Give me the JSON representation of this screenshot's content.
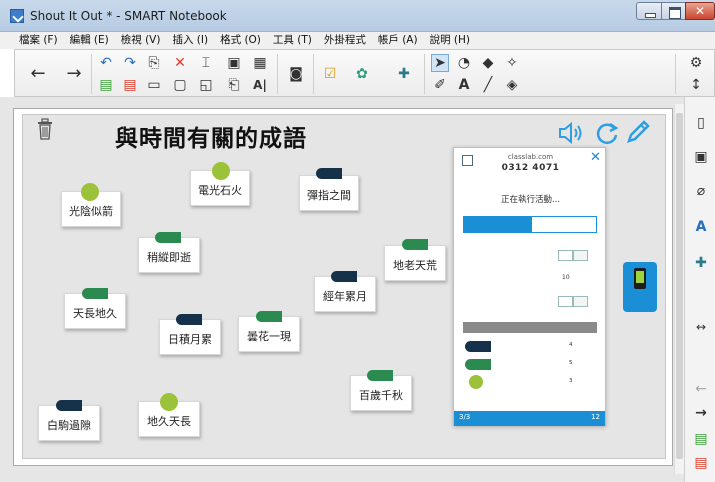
{
  "window": {
    "title": "Shout It Out * - SMART Notebook"
  },
  "menu": [
    "檔案 (F)",
    "編輯 (E)",
    "檢視 (V)",
    "插入 (I)",
    "格式 (O)",
    "工具 (T)",
    "外掛程式",
    "帳戶 (A)",
    "說明 (H)"
  ],
  "canvas": {
    "title": "與時間有關的成語",
    "cards": [
      {
        "text": "光陰似箭",
        "marker": "dot",
        "marker_text": ""
      },
      {
        "text": "電光石火",
        "marker": "dot",
        "marker_text": ""
      },
      {
        "text": "彈指之間",
        "marker": "navy",
        "marker_text": ""
      },
      {
        "text": "稍縱即逝",
        "marker": "green",
        "marker_text": ""
      },
      {
        "text": "地老天荒",
        "marker": "green",
        "marker_text": ""
      },
      {
        "text": "經年累月",
        "marker": "navy",
        "marker_text": ""
      },
      {
        "text": "天長地久",
        "marker": "green",
        "marker_text": ""
      },
      {
        "text": "日積月累",
        "marker": "navy",
        "marker_text": ""
      },
      {
        "text": "曇花一現",
        "marker": "green",
        "marker_text": ""
      },
      {
        "text": "百歲千秋",
        "marker": "green",
        "marker_text": ""
      },
      {
        "text": "白駒過隙",
        "marker": "navy",
        "marker_text": ""
      },
      {
        "text": "地久天長",
        "marker": "dot",
        "marker_text": ""
      }
    ]
  },
  "panel": {
    "site": "classlab.com",
    "code": "0312 4071",
    "status": "正在執行活動...",
    "tab_active": "",
    "tab_inactive": "",
    "settings": [
      {
        "label": "",
        "type": "toggle"
      },
      {
        "label": "",
        "value": "10"
      },
      {
        "label": "",
        "type": "toggle"
      }
    ],
    "table_rows": [
      {
        "name": "",
        "count": "4",
        "marker": "navy"
      },
      {
        "name": "",
        "count": "5",
        "marker": "green"
      },
      {
        "name": "",
        "count": "3",
        "marker": "dot"
      }
    ],
    "footer_left": "3/3",
    "footer_right": "12"
  },
  "colors": {
    "accent": "#1b8fd6",
    "tag_green": "#2a8a4f",
    "tag_navy": "#15324a",
    "dot_green": "#9cc23a"
  }
}
